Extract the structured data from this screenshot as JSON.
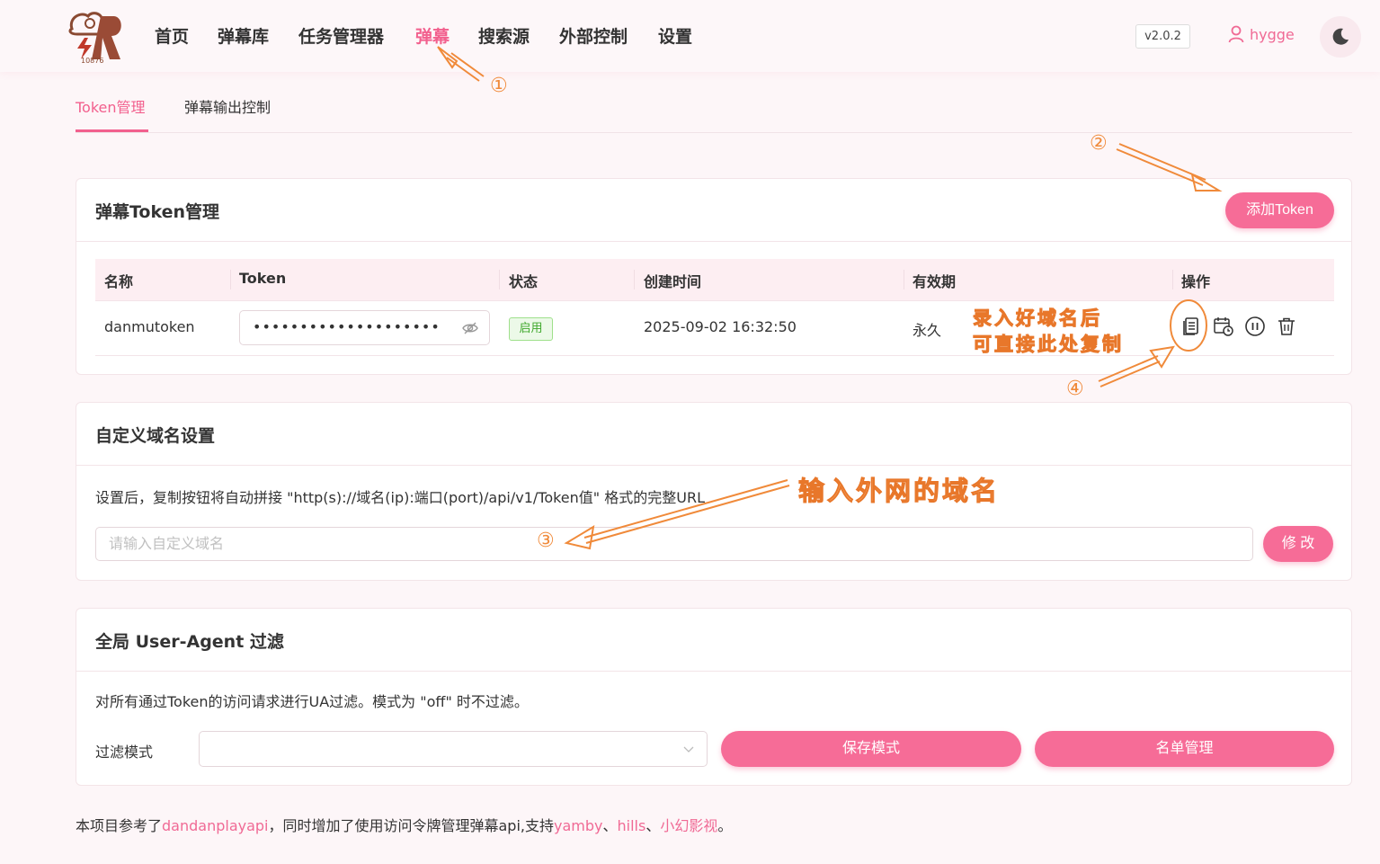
{
  "header": {
    "logo_text": "10876",
    "nav": [
      {
        "label": "首页",
        "active": false
      },
      {
        "label": "弹幕库",
        "active": false
      },
      {
        "label": "任务管理器",
        "active": false
      },
      {
        "label": "弹幕",
        "active": true
      },
      {
        "label": "搜索源",
        "active": false
      },
      {
        "label": "外部控制",
        "active": false
      },
      {
        "label": "设置",
        "active": false
      }
    ],
    "version": "v2.0.2",
    "username": "hygge",
    "theme_icon": "moon-icon"
  },
  "tabs": [
    {
      "label": "Token管理",
      "active": true
    },
    {
      "label": "弹幕输出控制",
      "active": false
    }
  ],
  "token_card": {
    "title": "弹幕Token管理",
    "add_button": "添加Token",
    "columns": [
      "名称",
      "Token",
      "状态",
      "创建时间",
      "有效期",
      "操作"
    ],
    "rows": [
      {
        "name": "danmutoken",
        "token_masked": "••••••••••••••••••••",
        "status": "启用",
        "created": "2025-09-02 16:32:50",
        "validity": "永久",
        "actions": [
          "copy-icon",
          "calendar-clock-icon",
          "pause-icon",
          "trash-icon"
        ]
      }
    ]
  },
  "domain_card": {
    "title": "自定义域名设置",
    "description": "设置后，复制按钮将自动拼接 \"http(s)://域名(ip):端口(port)/api/v1/Token值\" 格式的完整URL",
    "input_placeholder": "请输入自定义域名",
    "input_value": "",
    "submit_button": "修 改"
  },
  "ua_card": {
    "title": "全局 User-Agent 过滤",
    "description": "对所有通过Token的访问请求进行UA过滤。模式为 \"off\" 时不过滤。",
    "mode_label": "过滤模式",
    "mode_value": "",
    "save_button": "保存模式",
    "list_button": "名单管理"
  },
  "footer": {
    "prefix": "本项目参考了",
    "link1": "dandanplayapi",
    "middle": "，同时增加了使用访问令牌管理弹幕api,支持",
    "link2": "yamby",
    "sep1": "、",
    "link3": "hills",
    "sep2": "、",
    "link4": "小幻影视",
    "suffix": "。"
  },
  "annotations": {
    "step1": "①",
    "step2": "②",
    "step3": "③",
    "step4": "④",
    "note_copy_line1": "录入好域名后",
    "note_copy_line2": "可直接此处复制",
    "note_domain": "输入外网的域名"
  },
  "colors": {
    "accent": "#f2608e",
    "button": "#f66c97",
    "annotation": "#f08a3a",
    "status_green": "#3fa82c"
  }
}
